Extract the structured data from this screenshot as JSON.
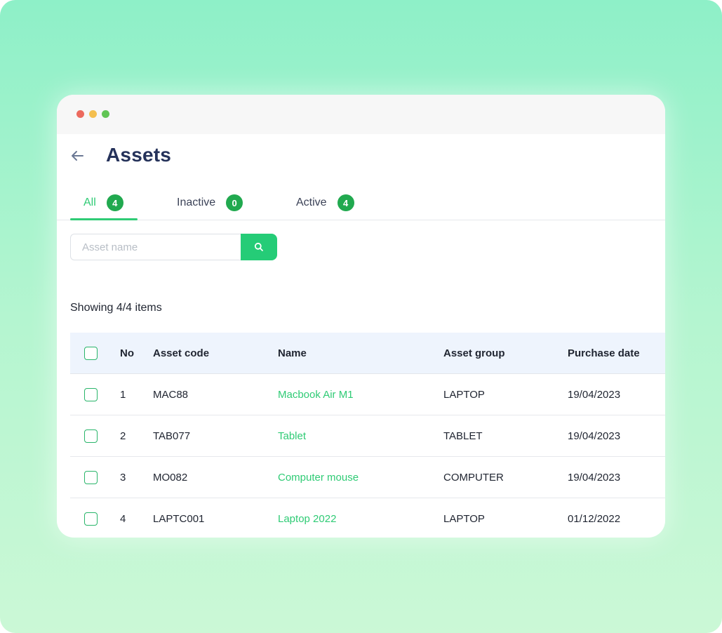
{
  "page": {
    "title": "Assets"
  },
  "tabs": [
    {
      "label": "All",
      "count": "4"
    },
    {
      "label": "Inactive",
      "count": "0"
    },
    {
      "label": "Active",
      "count": "4"
    }
  ],
  "search": {
    "placeholder": "Asset name",
    "value": ""
  },
  "summary": {
    "showing_text": "Showing 4/4 items"
  },
  "table": {
    "columns": {
      "no": "No",
      "code": "Asset code",
      "name": "Name",
      "group": "Asset group",
      "date": "Purchase date"
    },
    "rows": [
      {
        "no": "1",
        "code": "MAC88",
        "name": "Macbook Air M1",
        "group": "LAPTOP",
        "date": "19/04/2023"
      },
      {
        "no": "2",
        "code": "TAB077",
        "name": "Tablet",
        "group": "TABLET",
        "date": "19/04/2023"
      },
      {
        "no": "3",
        "code": "MO082",
        "name": "Computer mouse",
        "group": "COMPUTER",
        "date": "19/04/2023"
      },
      {
        "no": "4",
        "code": "LAPTC001",
        "name": "Laptop 2022",
        "group": "LAPTOP",
        "date": "01/12/2022"
      }
    ]
  },
  "colors": {
    "accent": "#2fcb75",
    "badge": "#21a94f",
    "title": "#25325a",
    "header_bg": "#eef4fd"
  },
  "icons": {
    "back": "arrow-left-icon",
    "search": "search-icon"
  }
}
